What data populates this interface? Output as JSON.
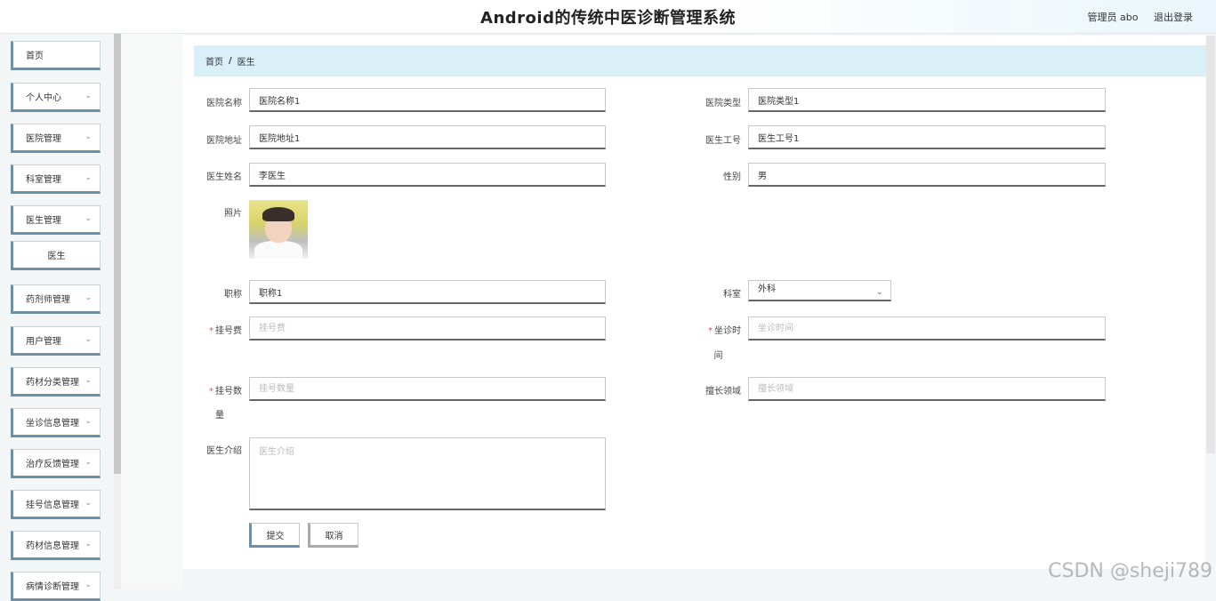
{
  "header": {
    "title": "Android的传统中医诊断管理系统",
    "user_label": "管理员 abo",
    "logout_label": "退出登录"
  },
  "sidebar": {
    "items": [
      {
        "label": "首页",
        "has_chevron": false
      },
      {
        "label": "个人中心",
        "has_chevron": true
      },
      {
        "label": "医院管理",
        "has_chevron": true
      },
      {
        "label": "科室管理",
        "has_chevron": true
      },
      {
        "label": "医生管理",
        "has_chevron": true
      },
      {
        "label": "医生",
        "has_chevron": false
      },
      {
        "label": "药剂师管理",
        "has_chevron": true
      },
      {
        "label": "用户管理",
        "has_chevron": true
      },
      {
        "label": "药材分类管理",
        "has_chevron": true
      },
      {
        "label": "坐诊信息管理",
        "has_chevron": true
      },
      {
        "label": "治疗反馈管理",
        "has_chevron": true
      },
      {
        "label": "挂号信息管理",
        "has_chevron": true
      },
      {
        "label": "药材信息管理",
        "has_chevron": true
      },
      {
        "label": "病情诊断管理",
        "has_chevron": true
      }
    ]
  },
  "breadcrumb": {
    "home": "首页",
    "separator": "/",
    "current": "医生"
  },
  "form": {
    "hospital_name": {
      "label": "医院名称",
      "value": "医院名称1"
    },
    "hospital_type": {
      "label": "医院类型",
      "value": "医院类型1"
    },
    "hospital_address": {
      "label": "医院地址",
      "value": "医院地址1"
    },
    "doctor_id": {
      "label": "医生工号",
      "value": "医生工号1"
    },
    "doctor_name": {
      "label": "医生姓名",
      "value": "李医生"
    },
    "gender": {
      "label": "性别",
      "value": "男"
    },
    "photo": {
      "label": "照片"
    },
    "title": {
      "label": "职称",
      "value": "职称1"
    },
    "department": {
      "label": "科室",
      "value": "外科"
    },
    "registration_fee": {
      "label_a": "挂号费",
      "placeholder": "挂号费",
      "required": "*"
    },
    "clinic_time": {
      "label_a": "坐诊时",
      "label_b": "间",
      "placeholder": "坐诊时间",
      "required": "*"
    },
    "registration_count": {
      "label_a": "挂号数",
      "label_b": "量",
      "placeholder": "挂号数量",
      "required": "*"
    },
    "specialty": {
      "label": "擅长领域",
      "placeholder": "擅长领域"
    },
    "introduction": {
      "label": "医生介绍",
      "placeholder": "医生介绍"
    }
  },
  "buttons": {
    "submit": "提交",
    "cancel": "取消"
  },
  "watermark": "CSDN @sheji789"
}
